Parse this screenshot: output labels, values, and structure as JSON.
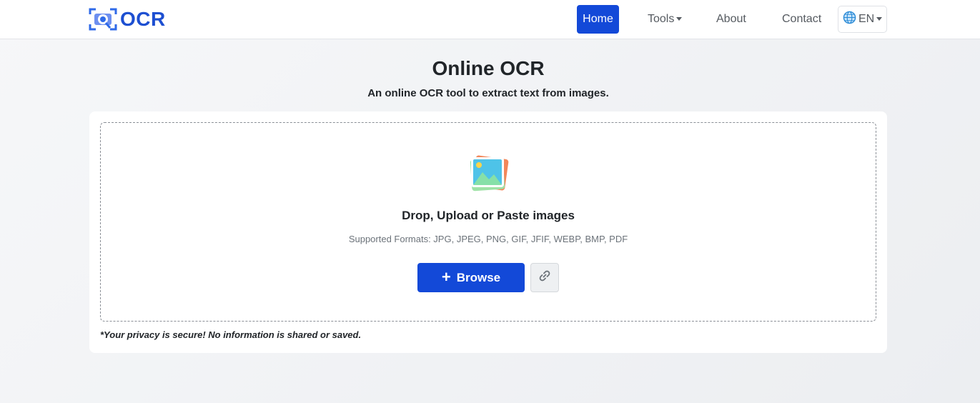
{
  "header": {
    "brand_text": "OCR",
    "nav": {
      "home": "Home",
      "tools": "Tools",
      "about": "About",
      "contact": "Contact",
      "language": "EN"
    }
  },
  "main": {
    "title": "Online OCR",
    "subtitle": "An online OCR tool to extract text from images.",
    "dropzone": {
      "heading": "Drop, Upload or Paste images",
      "formats": "Supported Formats: JPG, JPEG, PNG, GIF, JFIF, WEBP, BMP, PDF",
      "browse_label": "Browse",
      "browse_icon": "+",
      "link_icon": "link-icon"
    },
    "privacy_note": "*Your privacy is secure! No information is shared or saved."
  },
  "colors": {
    "primary": "#1349d8",
    "brand": "#1d4fd1"
  }
}
